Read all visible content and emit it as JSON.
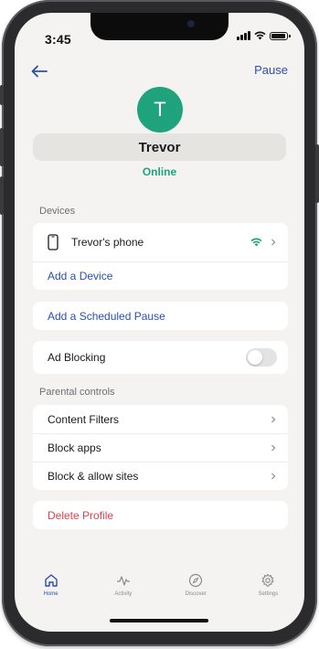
{
  "status_bar": {
    "time": "3:45"
  },
  "header": {
    "back_icon": "back-arrow-icon",
    "pause_label": "Pause"
  },
  "profile": {
    "initial": "T",
    "name": "Trevor",
    "status": "Online",
    "avatar_color": "#1ea37c"
  },
  "devices": {
    "section_title": "Devices",
    "items": [
      {
        "name": "Trevor's phone",
        "icon": "phone-icon",
        "status_icon": "wifi-icon"
      }
    ],
    "add_label": "Add a Device"
  },
  "scheduled_pause": {
    "label": "Add a Scheduled Pause"
  },
  "ad_blocking": {
    "label": "Ad Blocking",
    "enabled": false
  },
  "parental_controls": {
    "section_title": "Parental controls",
    "items": [
      {
        "label": "Content Filters"
      },
      {
        "label": "Block apps"
      },
      {
        "label": "Block & allow sites"
      }
    ]
  },
  "delete_profile": {
    "label": "Delete Profile"
  },
  "tabs": [
    {
      "label": "Home",
      "icon": "home-icon",
      "active": true
    },
    {
      "label": "Activity",
      "icon": "activity-icon",
      "active": false
    },
    {
      "label": "Discover",
      "icon": "compass-icon",
      "active": false
    },
    {
      "label": "Settings",
      "icon": "gear-icon",
      "active": false
    }
  ],
  "colors": {
    "accent_blue": "#2a4fb0",
    "brand_green": "#1ea37c",
    "danger_red": "#e0404f"
  }
}
